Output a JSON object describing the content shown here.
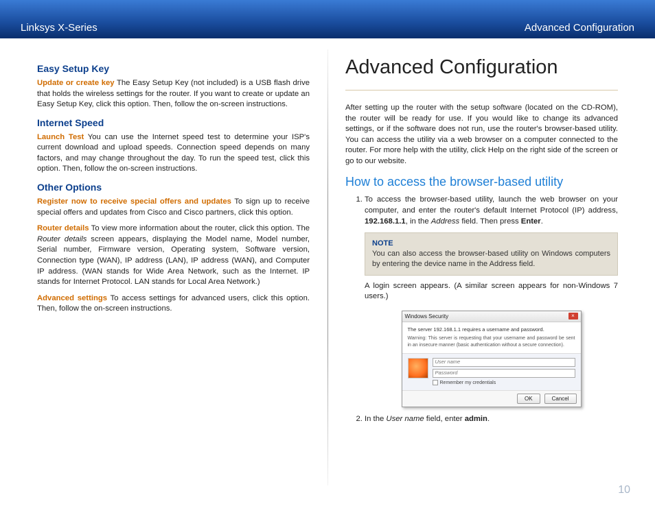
{
  "header": {
    "left": "Linksys X-Series",
    "right": "Advanced Configuration"
  },
  "left": {
    "s1": {
      "title": "Easy Setup Key",
      "lead": "Update or create key",
      "text": "  The Easy Setup Key (not included) is a USB flash drive that holds the wireless settings for the router. If you want to create or update an Easy Setup Key, click this option. Then, follow the on-screen instructions."
    },
    "s2": {
      "title": "Internet Speed",
      "lead": "Launch Test",
      "text": "  You can use the Internet speed test to determine your ISP's current download and upload speeds. Connection speed depends on many factors, and may change throughout the day. To run the speed test, click this option. Then, follow the on-screen instructions."
    },
    "s3": {
      "title": "Other Options",
      "p1lead": "Register now to receive special offers and updates",
      "p1text": "  To sign up to receive special offers and updates from Cisco and Cisco partners, click this option.",
      "p2lead": "Router details",
      "p2text_a": "  To view more information about the router, click this option. The ",
      "p2text_i": "Router details",
      "p2text_b": " screen appears, displaying the Model name, Model number, Serial number, Firmware version, Operating system, Software version, Connection type (WAN), IP address (LAN), IP address (WAN), and Computer IP address. (WAN stands for Wide Area Network, such as the Internet. IP stands for Internet Protocol. LAN stands for Local Area Network.)",
      "p3lead": "Advanced settings",
      "p3text": "  To access settings for advanced users, click this option. Then, follow the on-screen instructions."
    }
  },
  "right": {
    "title": "Advanced Configuration",
    "intro": "After setting up the router with the setup software (located on the CD-ROM), the router will be ready for use. If you would like to change its advanced settings, or if the software does not run, use the router's browser-based utility. You can access the utility via a web browser on a computer connected to the router. For more help with the utility, click Help on the right side of the screen or go to our website.",
    "h2": "How to access the browser-based utility",
    "step1_a": "To access the browser-based utility, launch the web browser on your computer, and enter the router's default Internet Protocol (IP) address, ",
    "step1_ip": "192.168.1.1",
    "step1_b": ", in the ",
    "step1_addr": "Address",
    "step1_c": " field. Then press ",
    "step1_enter": "Enter",
    "step1_d": ".",
    "note_label": "NOTE",
    "note_text": "You can also access the browser-based utility on Windows computers by entering the device name in the Address field.",
    "after_note": "A login screen appears. (A similar screen appears for non-Windows 7 users.)",
    "step2_a": "In the ",
    "step2_i": "User name",
    "step2_b": " field, enter ",
    "step2_admin": "admin",
    "step2_c": "."
  },
  "dialog": {
    "title": "Windows Security",
    "line1": "The server 192.168.1.1 requires a username and password.",
    "warn": "Warning: This server is requesting that your username and password be sent in an insecure manner (basic authentication without a secure connection).",
    "user_ph": "User name",
    "pass_ph": "Password",
    "remember": "Remember my credentials",
    "ok": "OK",
    "cancel": "Cancel"
  },
  "page_number": "10"
}
